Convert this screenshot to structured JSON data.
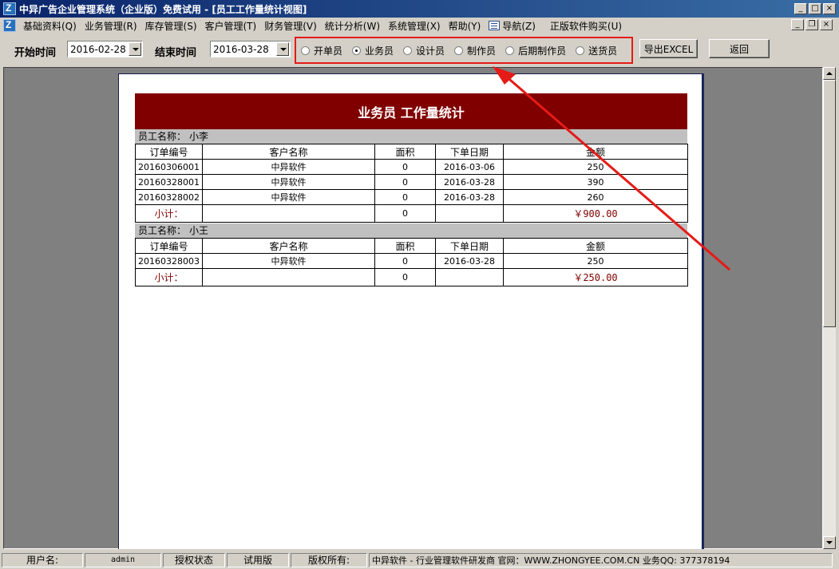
{
  "window": {
    "title": "中异广告企业管理系统（企业版）免费试用 - [员工工作量统计视图]"
  },
  "menu": {
    "items": [
      "基础资料(Q)",
      "业务管理(R)",
      "库存管理(S)",
      "客户管理(T)",
      "财务管理(V)",
      "统计分析(W)",
      "系统管理(X)",
      "帮助(Y)",
      "导航(Z)",
      "正版软件购买(U)"
    ]
  },
  "toolbar": {
    "start_label": "开始时间",
    "start_value": "2016-02-28",
    "end_label": "结束时间",
    "end_value": "2016-03-28",
    "roles": [
      "开单员",
      "业务员",
      "设计员",
      "制作员",
      "后期制作员",
      "送货员"
    ],
    "selected_role": "业务员",
    "export_label": "导出EXCEL",
    "back_label": "返回"
  },
  "report": {
    "title": "业务员 工作量统计",
    "columns": [
      "订单编号",
      "客户名称",
      "面积",
      "下单日期",
      "金额"
    ],
    "employee_label": "员工名称：",
    "subtotal_label": "小计：",
    "groups": [
      {
        "employee": "小李",
        "rows": [
          [
            "20160306001",
            "中异软件",
            "0",
            "2016-03-06",
            "250"
          ],
          [
            "20160328001",
            "中异软件",
            "0",
            "2016-03-28",
            "390"
          ],
          [
            "20160328002",
            "中异软件",
            "0",
            "2016-03-28",
            "260"
          ]
        ],
        "subtotal_area": "0",
        "subtotal_amount": "￥900.00"
      },
      {
        "employee": "小王",
        "rows": [
          [
            "20160328003",
            "中异软件",
            "0",
            "2016-03-28",
            "250"
          ]
        ],
        "subtotal_area": "0",
        "subtotal_amount": "￥250.00"
      }
    ]
  },
  "statusbar": {
    "user_label": "用户名:",
    "user_value": "admin",
    "auth_label": "授权状态",
    "auth_value": "试用版",
    "copyright_label": "版权所有:",
    "copyright_value": "中异软件 - 行业管理软件研发商 官网：WWW.ZHONGYEE.COM.CN  业务QQ: 377378194"
  },
  "colors": {
    "report_header": "#800000",
    "highlight_box": "#e41b17",
    "group_header": "#c0c0c0"
  }
}
